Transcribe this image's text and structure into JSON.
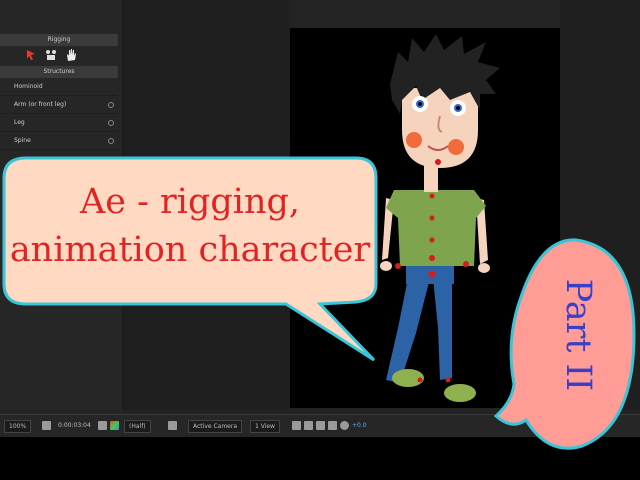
{
  "left_panel": {
    "rigging_header": "Rigging",
    "structures_header": "Structures",
    "structures": [
      {
        "label": "Hominoid"
      },
      {
        "label": "Arm (or front leg)"
      },
      {
        "label": "Leg"
      },
      {
        "label": "Spine"
      }
    ]
  },
  "toolbar": {
    "zoom_select": "100%",
    "timecode": "0:00:03:04",
    "resolution_select": "(Half)",
    "camera_select": "Active Camera",
    "view_select": "1 View",
    "exposure_value": "+0.0"
  },
  "overlay": {
    "title_line1": "Ae - rigging,",
    "title_line2": "animation character",
    "part_label": "Part II"
  },
  "colors": {
    "title_text": "#e02424",
    "part_text": "#3b3fc8",
    "left_bubble_fill": "#ffd9c2",
    "right_bubble_fill": "#ff9c95",
    "bubble_stroke": "#39c5d8",
    "shirt": "#7ea44e",
    "jeans": "#2b63a6",
    "skin": "#f5d3bd",
    "hair": "#222222",
    "rig_pin": "#d81b1b"
  },
  "icons": [
    "rig-pin-icon",
    "puppet-icon",
    "hand-icon",
    "camera-icon",
    "color-wheel-icon",
    "region-icon",
    "transparency-grid-icon"
  ]
}
